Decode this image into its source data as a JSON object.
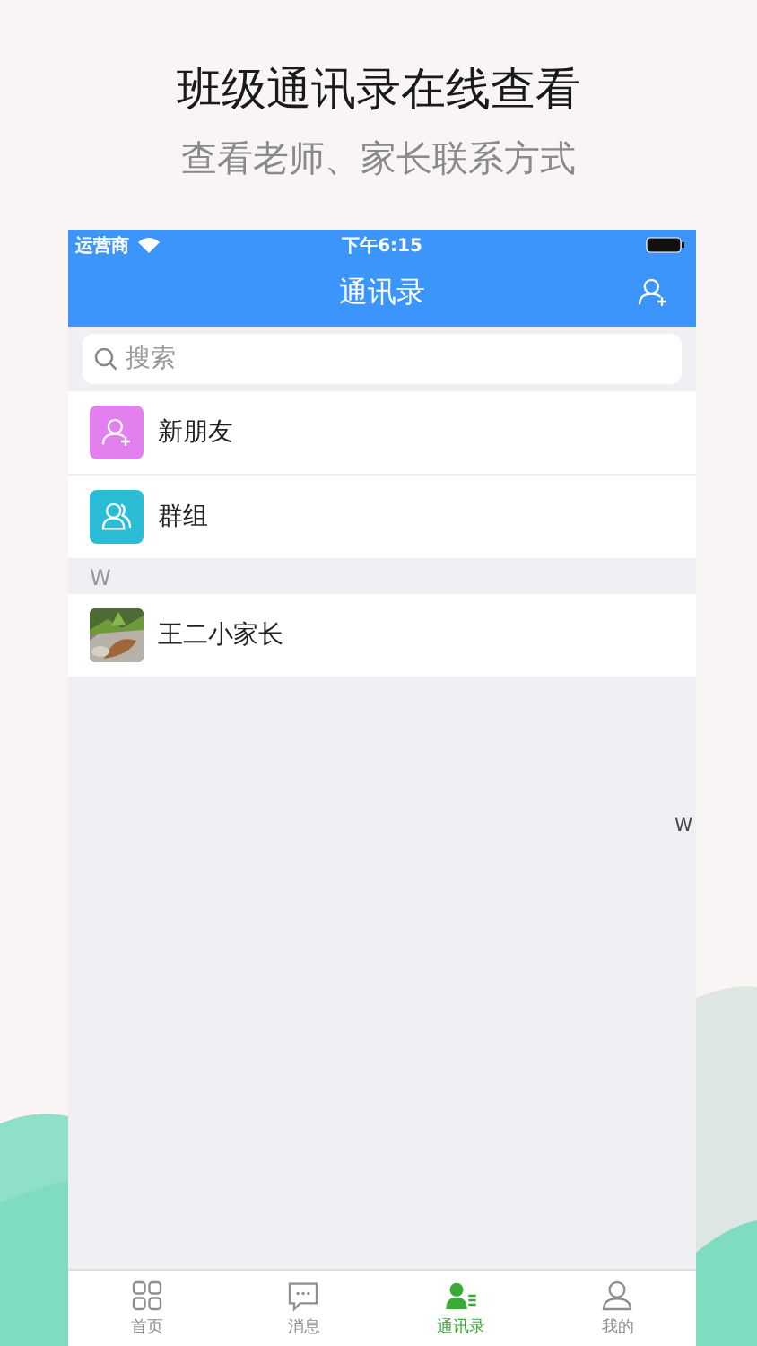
{
  "promo": {
    "title": "班级通讯录在线查看",
    "subtitle": "查看老师、家长联系方式"
  },
  "status_bar": {
    "carrier": "运营商",
    "time": "下午6:15"
  },
  "nav": {
    "title": "通讯录"
  },
  "search": {
    "placeholder": "搜索"
  },
  "shortcuts": [
    {
      "label": "新朋友",
      "kind": "new-friend",
      "color": "#e280f0"
    },
    {
      "label": "群组",
      "kind": "group",
      "color": "#2bbcd6"
    }
  ],
  "sections": [
    {
      "letter": "W",
      "contacts": [
        {
          "name": "王二小家长"
        }
      ]
    }
  ],
  "index": [
    "W"
  ],
  "tabs": [
    {
      "label": "首页",
      "kind": "home",
      "selected": false
    },
    {
      "label": "消息",
      "kind": "message",
      "selected": false
    },
    {
      "label": "通讯录",
      "kind": "contacts",
      "selected": true
    },
    {
      "label": "我的",
      "kind": "profile",
      "selected": false
    }
  ]
}
